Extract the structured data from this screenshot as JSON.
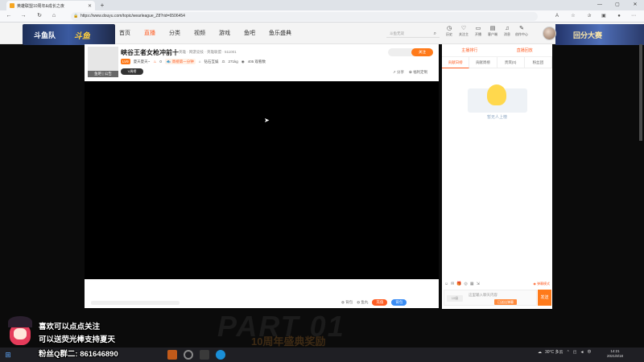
{
  "browser": {
    "tab_title": "英雄联盟10周年&成长之夜",
    "url": "https://www.douyu.com/topic/wearleague_Z8?rid=6506454",
    "window_controls": [
      "—",
      "▢",
      "✕"
    ]
  },
  "site": {
    "left_banner": "斗鱼队",
    "left_logo": "斗鱼",
    "right_banner": "回分大赛",
    "nav": [
      "首页",
      "直播",
      "分类",
      "视频",
      "游戏",
      "鱼吧",
      "鱼乐盛典"
    ],
    "active_nav": "直播",
    "search_placeholder": "斗鱼无双",
    "user_nav": [
      {
        "icon": "history-icon",
        "label": "历史"
      },
      {
        "icon": "follow-icon",
        "label": "关注主"
      },
      {
        "icon": "broadcast-icon",
        "label": "开播"
      },
      {
        "icon": "message-icon",
        "label": "客户端"
      },
      {
        "icon": "bell-icon",
        "label": "消息"
      },
      {
        "icon": "creator-icon",
        "label": "创作中心"
      }
    ]
  },
  "room": {
    "thumb_label": "鱼吧 | 公告",
    "title": "峡谷王者女枪冲前十",
    "category": "英雄 · 网游竞技 · 英雄联盟 · 511001",
    "level_tag": "LV9",
    "streamer": "夏天夏天~",
    "hot_count": "0",
    "rank_tag": "🐟 周榜第一分钟",
    "guild": "钻石互娱",
    "weight": "271kg",
    "viewers": "405 观看数",
    "video_badge": "V周榜",
    "follow": "关注",
    "share": "分享",
    "welfare": "福利定制"
  },
  "gifts": {
    "item1": "背包",
    "item2": "鱼丸",
    "recharge": "充值",
    "backpack": "背包"
  },
  "side": {
    "header": [
      "主播排行",
      "直播回放"
    ],
    "tabs": [
      "贡献日榜",
      "贡献周榜",
      "贵宾(0)",
      "粉丝团"
    ],
    "empty_caption": "暂无人上榜",
    "chat_tools": [
      "☺",
      "✉",
      "🎁",
      "◎",
      "▦",
      "⇲"
    ],
    "chat_mode": "◉ 弹幕模式",
    "level_badge": "10级",
    "input_placeholder": "这里输入聊天内容",
    "input_tag": "已送出弹幕",
    "send": "发送"
  },
  "overlay": {
    "line1": "喜欢可以点点关注",
    "line2": "可以送荧光棒支持夏天",
    "line3_label": "粉丝Q群二: ",
    "line3_number": "861646890",
    "bg_text": "PART 01",
    "ceremony": "10周年盛典奖励"
  },
  "taskbar": {
    "weather": "30°C 多云",
    "time": "14:21",
    "date": "2021/8/18",
    "ime": "中"
  }
}
